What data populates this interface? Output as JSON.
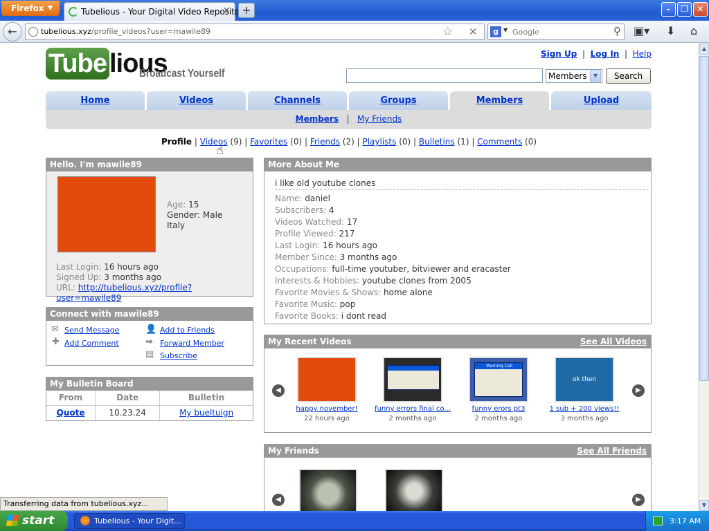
{
  "browser": {
    "menu_label": "Firefox",
    "tab_title": "Tubelious - Your Digital Video Repository",
    "tab_close": "×",
    "new_tab": "+",
    "url_domain": "tubelious.xyz",
    "url_path": "/profile_videos?user=mawile89",
    "search_engine_placeholder": "Google",
    "status_text": "Transferring data from tubelious.xyz..."
  },
  "site": {
    "logo_part1": "Tube",
    "logo_part2": "lious",
    "tagline": "Broadcast Yourself",
    "top_links": {
      "signup": "Sign Up",
      "login": "Log In",
      "help": "Help"
    },
    "search": {
      "select_value": "Members",
      "button": "Search"
    },
    "tabs": [
      "Home",
      "Videos",
      "Channels",
      "Groups",
      "Members",
      "Upload"
    ],
    "subnav": {
      "members": "Members",
      "friends": "My Friends"
    }
  },
  "profile_nav": {
    "profile": "Profile",
    "videos": "Videos",
    "videos_count": "(9)",
    "favorites": "Favorites",
    "favorites_count": "(0)",
    "friends": "Friends",
    "friends_count": "(2)",
    "playlists": "Playlists",
    "playlists_count": "(0)",
    "bulletins": "Bulletins",
    "bulletins_count": "(1)",
    "comments": "Comments",
    "comments_count": "(0)"
  },
  "hello": {
    "title": "Hello. I'm mawile89",
    "avatar_color": "#e24a0e",
    "age_label": "Age:",
    "age": "15",
    "gender": "Gender: Male",
    "country": "Italy",
    "last_login_label": "Last Login:",
    "last_login": "16 hours ago",
    "signed_up_label": "Signed Up:",
    "signed_up": "3 months ago",
    "url_label": "URL:",
    "url": "http://tubelious.xyz/profile?user=mawile89"
  },
  "connect": {
    "title": "Connect with mawile89",
    "send_message": "Send Message",
    "add_comment": "Add Comment",
    "add_friends": "Add to Friends",
    "forward_member": "Forward Member",
    "subscribe": "Subscribe"
  },
  "bulletin": {
    "title": "My Bulletin Board",
    "headers": [
      "From",
      "Date",
      "Bulletin"
    ],
    "rows": [
      {
        "from": "Quote",
        "date": "10.23.24",
        "bulletin": "My bueltuign"
      }
    ]
  },
  "about": {
    "title": "More About Me",
    "bio": "i like old youtube clones",
    "fields": [
      {
        "label": "Name:",
        "value": "daniel"
      },
      {
        "label": "Subscribers:",
        "value": "4"
      },
      {
        "label": "Videos Watched:",
        "value": "17"
      },
      {
        "label": "Profile Viewed:",
        "value": "217"
      },
      {
        "label": "Last Login:",
        "value": "16 hours ago"
      },
      {
        "label": "Member Since:",
        "value": "3 months ago"
      },
      {
        "label": "Occupations:",
        "value": "full-time youtuber, bitviewer and eracaster"
      },
      {
        "label": "Interests & Hobbies:",
        "value": "youtube clones from 2005"
      },
      {
        "label": "Favorite Movies & Shows:",
        "value": "home alone"
      },
      {
        "label": "Favorite Music:",
        "value": "pop"
      },
      {
        "label": "Favorite Books:",
        "value": "i dont read"
      }
    ]
  },
  "recent_videos": {
    "title": "My Recent Videos",
    "see_all": "See All Videos",
    "items": [
      {
        "title": "happy november!",
        "age": "22 hours ago",
        "thumb_color": "#e24a0e",
        "thumb_text": ""
      },
      {
        "title": "funny errors final co...",
        "age": "2 months ago",
        "thumb_color": "#2a2a2a",
        "thumb_text": ""
      },
      {
        "title": "funny erors pt3",
        "age": "2 months ago",
        "thumb_color": "#3a5ea8",
        "thumb_text": "Warning Call"
      },
      {
        "title": "1 sub + 200 views!!",
        "age": "3 months ago",
        "thumb_color": "#1f6aa5",
        "thumb_text": "ok then"
      }
    ]
  },
  "friends": {
    "title": "My Friends",
    "see_all": "See All Friends"
  },
  "taskbar": {
    "start": "start",
    "task": "Tubelious - Your Digit...",
    "clock": "3:17 AM"
  }
}
